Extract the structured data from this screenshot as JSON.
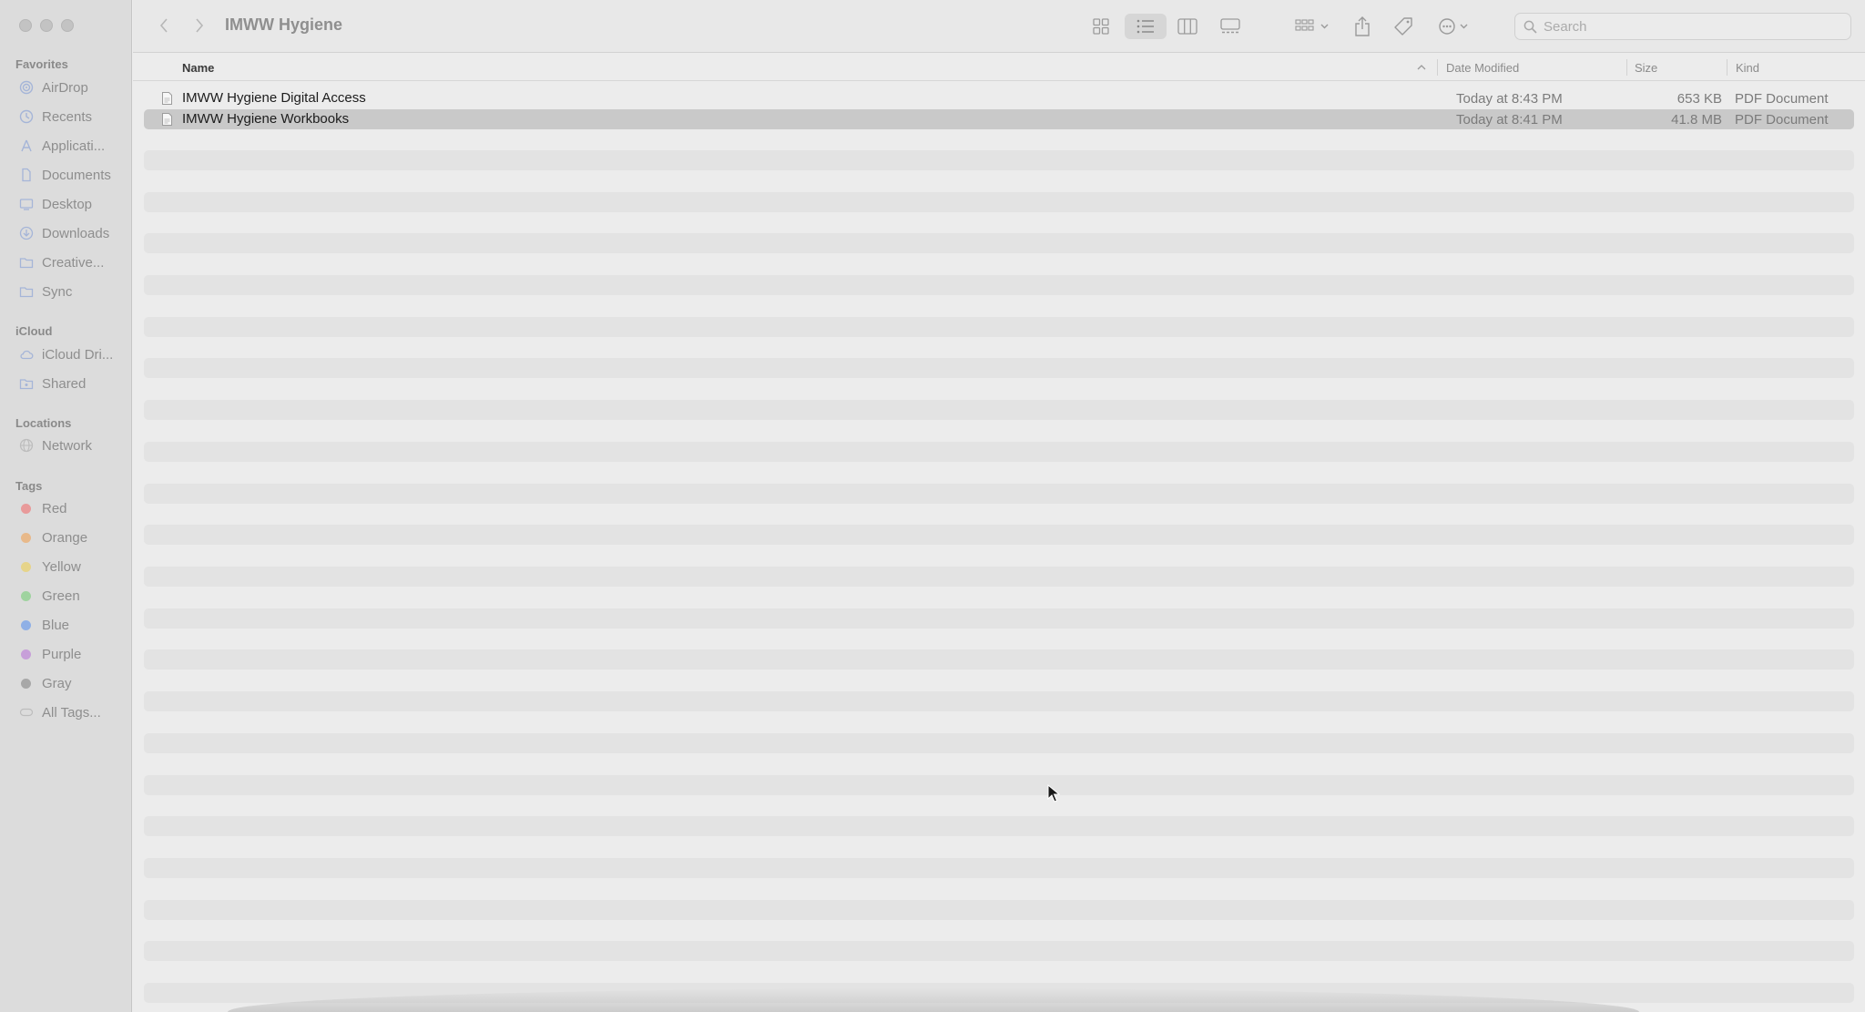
{
  "window": {
    "title": "IMWW Hygiene"
  },
  "sidebar": {
    "favorites_heading": "Favorites",
    "favorites": [
      {
        "label": "AirDrop",
        "icon": "airdrop-icon"
      },
      {
        "label": "Recents",
        "icon": "clock-icon"
      },
      {
        "label": "Applicati...",
        "icon": "applications-icon"
      },
      {
        "label": "Documents",
        "icon": "document-icon"
      },
      {
        "label": "Desktop",
        "icon": "desktop-icon"
      },
      {
        "label": "Downloads",
        "icon": "download-icon"
      },
      {
        "label": "Creative...",
        "icon": "folder-icon"
      },
      {
        "label": "Sync",
        "icon": "folder-icon"
      }
    ],
    "icloud_heading": "iCloud",
    "icloud": [
      {
        "label": "iCloud Dri...",
        "icon": "cloud-icon"
      },
      {
        "label": "Shared",
        "icon": "shared-folder-icon"
      }
    ],
    "locations_heading": "Locations",
    "locations": [
      {
        "label": "Network",
        "icon": "globe-icon"
      }
    ],
    "tags_heading": "Tags",
    "tags": [
      {
        "label": "Red",
        "color": "#e89a9a"
      },
      {
        "label": "Orange",
        "color": "#e8b98a"
      },
      {
        "label": "Yellow",
        "color": "#e6d48a"
      },
      {
        "label": "Green",
        "color": "#9fd39f"
      },
      {
        "label": "Blue",
        "color": "#8fb0e6"
      },
      {
        "label": "Purple",
        "color": "#c79fd9"
      },
      {
        "label": "Gray",
        "color": "#a8a8a8"
      }
    ],
    "all_tags": "All Tags..."
  },
  "toolbar": {
    "search_placeholder": "Search"
  },
  "columns": {
    "name": "Name",
    "date": "Date Modified",
    "size": "Size",
    "kind": "Kind"
  },
  "files": [
    {
      "name": "IMWW Hygiene Digital Access",
      "date": "Today at 8:43 PM",
      "size": "653 KB",
      "kind": "PDF Document",
      "selected": false
    },
    {
      "name": "IMWW Hygiene Workbooks",
      "date": "Today at 8:41 PM",
      "size": "41.8 MB",
      "kind": "PDF Document",
      "selected": true
    }
  ],
  "colors": {
    "sidebar_bg": "#dcdcdc",
    "selected_row": "#c9c9c9",
    "stripe": "#e3e3e3"
  }
}
